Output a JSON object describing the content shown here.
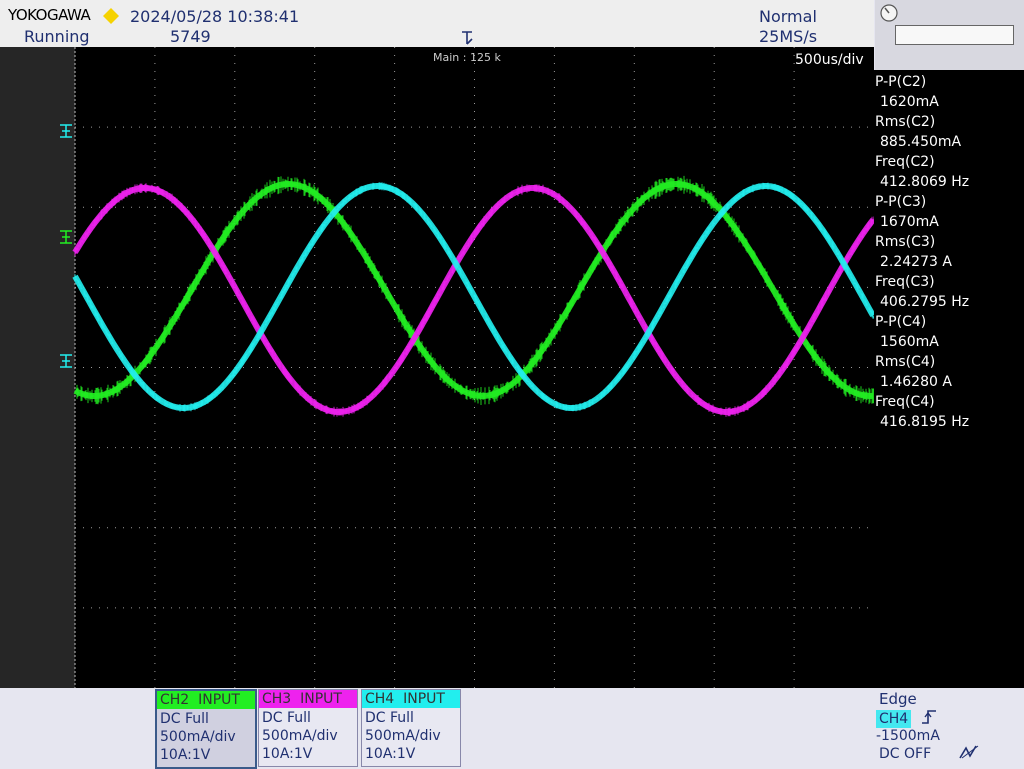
{
  "header": {
    "brand": "YOKOGAWA",
    "datetime": "2024/05/28 10:38:41",
    "status": "Running",
    "acq_count": "5749",
    "mode": "Normal",
    "sample_rate": "25MS/s",
    "main_record": "Main : 125 k",
    "timebase": "500us/div"
  },
  "measurements": [
    {
      "label": "P-P(C2)",
      "value": "1620mA"
    },
    {
      "label": "Rms(C2)",
      "value": "885.450mA"
    },
    {
      "label": "Freq(C2)",
      "value": "412.8069 Hz"
    },
    {
      "label": "P-P(C3)",
      "value": "1670mA"
    },
    {
      "label": "Rms(C3)",
      "value": "2.24273 A"
    },
    {
      "label": "Freq(C3)",
      "value": "406.2795 Hz"
    },
    {
      "label": "P-P(C4)",
      "value": "1560mA"
    },
    {
      "label": "Rms(C4)",
      "value": "1.46280 A"
    },
    {
      "label": "Freq(C4)",
      "value": "416.8195 Hz"
    }
  ],
  "channels": [
    {
      "name": "CH2",
      "input": "INPUT",
      "coupling": "DC Full",
      "scale": "500mA/div",
      "probe": "10A:1V",
      "color": "#22ee22"
    },
    {
      "name": "CH3",
      "input": "INPUT",
      "coupling": "DC Full",
      "scale": "500mA/div",
      "probe": "10A:1V",
      "color": "#ee22ee"
    },
    {
      "name": "CH4",
      "input": "INPUT",
      "coupling": "DC Full",
      "scale": "500mA/div",
      "probe": "10A:1V",
      "color": "#22eeee"
    }
  ],
  "trigger": {
    "type": "Edge",
    "source": "CH4",
    "level": "-1500mA",
    "coupling": "DC OFF"
  },
  "colors": {
    "ch2": "#22ee22",
    "ch3": "#ee22ee",
    "ch4": "#22eeee",
    "grid": "#9a9a9a",
    "plot_bg": "#000000"
  }
}
